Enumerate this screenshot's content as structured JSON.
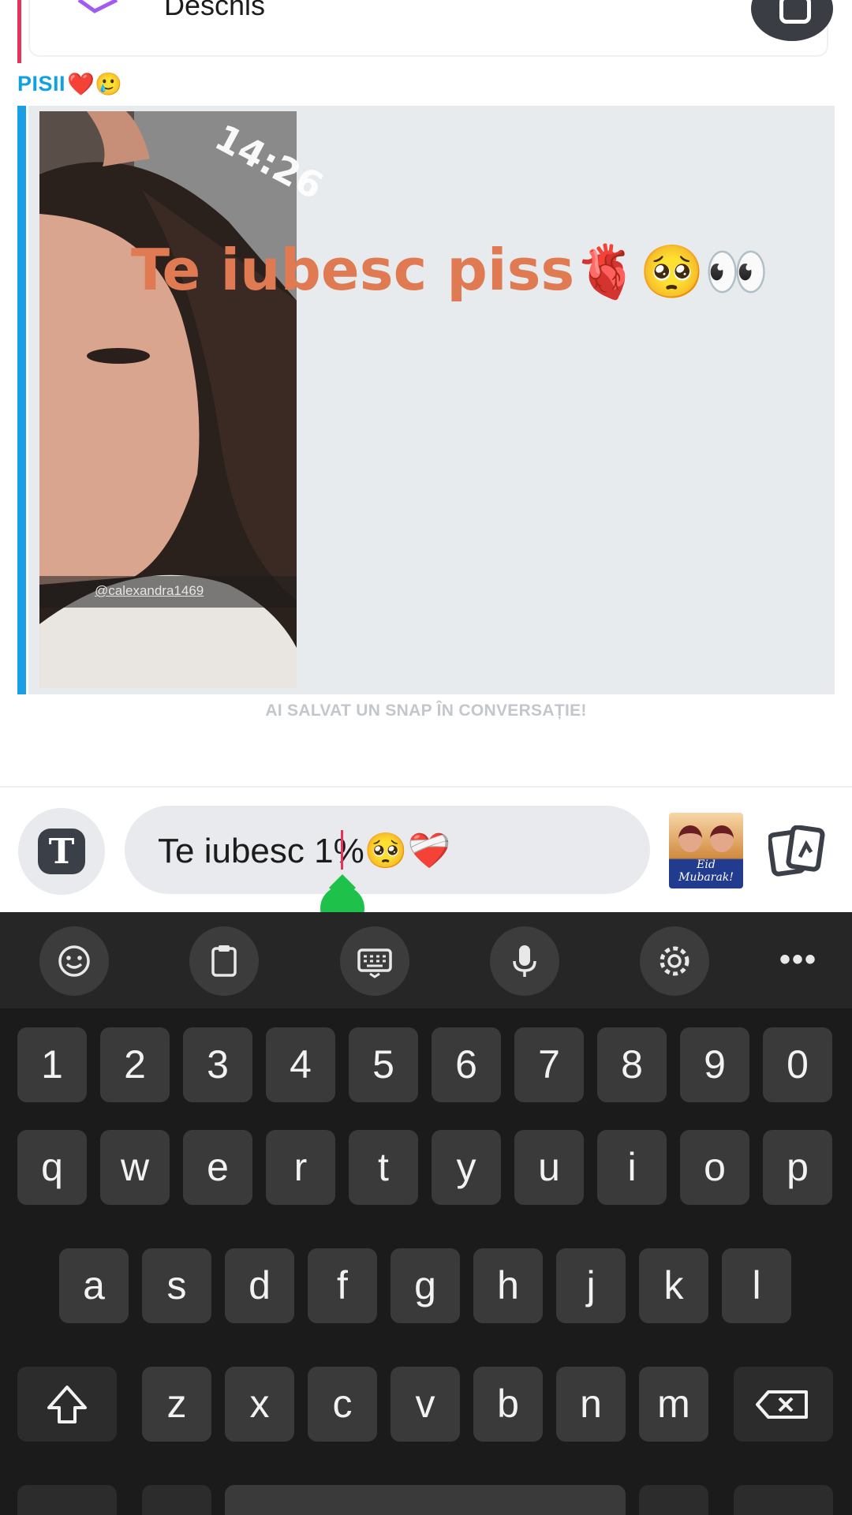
{
  "previous_message": {
    "label": "Deschis",
    "icon": "sent-arrow-icon"
  },
  "sender": {
    "name": "PISII",
    "emoji": "❤️🥲"
  },
  "snap": {
    "time_overlay": "14:26",
    "caption_text": "Te iubesc piss",
    "caption_emoji": "🫀🥺👀",
    "handle": "@calexandra1469"
  },
  "saved_notice": "AI SALVAT UN SNAP ÎN CONVERSAȚIE!",
  "composer": {
    "text": "Te iubesc 1%",
    "emoji": "🥺❤️‍🩹",
    "sticker_label": "Eid Mubarak!"
  },
  "keyboard": {
    "toolbar": [
      "emoji-icon",
      "clipboard-icon",
      "keyboard-icon",
      "microphone-icon",
      "settings-icon",
      "more-icon"
    ],
    "more_label": "•••",
    "row_numbers": [
      "1",
      "2",
      "3",
      "4",
      "5",
      "6",
      "7",
      "8",
      "9",
      "0"
    ],
    "row1": [
      "q",
      "w",
      "e",
      "r",
      "t",
      "y",
      "u",
      "i",
      "o",
      "p"
    ],
    "row2": [
      "a",
      "s",
      "d",
      "f",
      "g",
      "h",
      "j",
      "k",
      "l"
    ],
    "row3": [
      "z",
      "x",
      "c",
      "v",
      "b",
      "n",
      "m"
    ]
  },
  "colors": {
    "accent_pink": "#e6335a",
    "accent_blue": "#1a9ee4",
    "caption": "#e07a52",
    "keyboard_bg": "#1b1b1b"
  }
}
